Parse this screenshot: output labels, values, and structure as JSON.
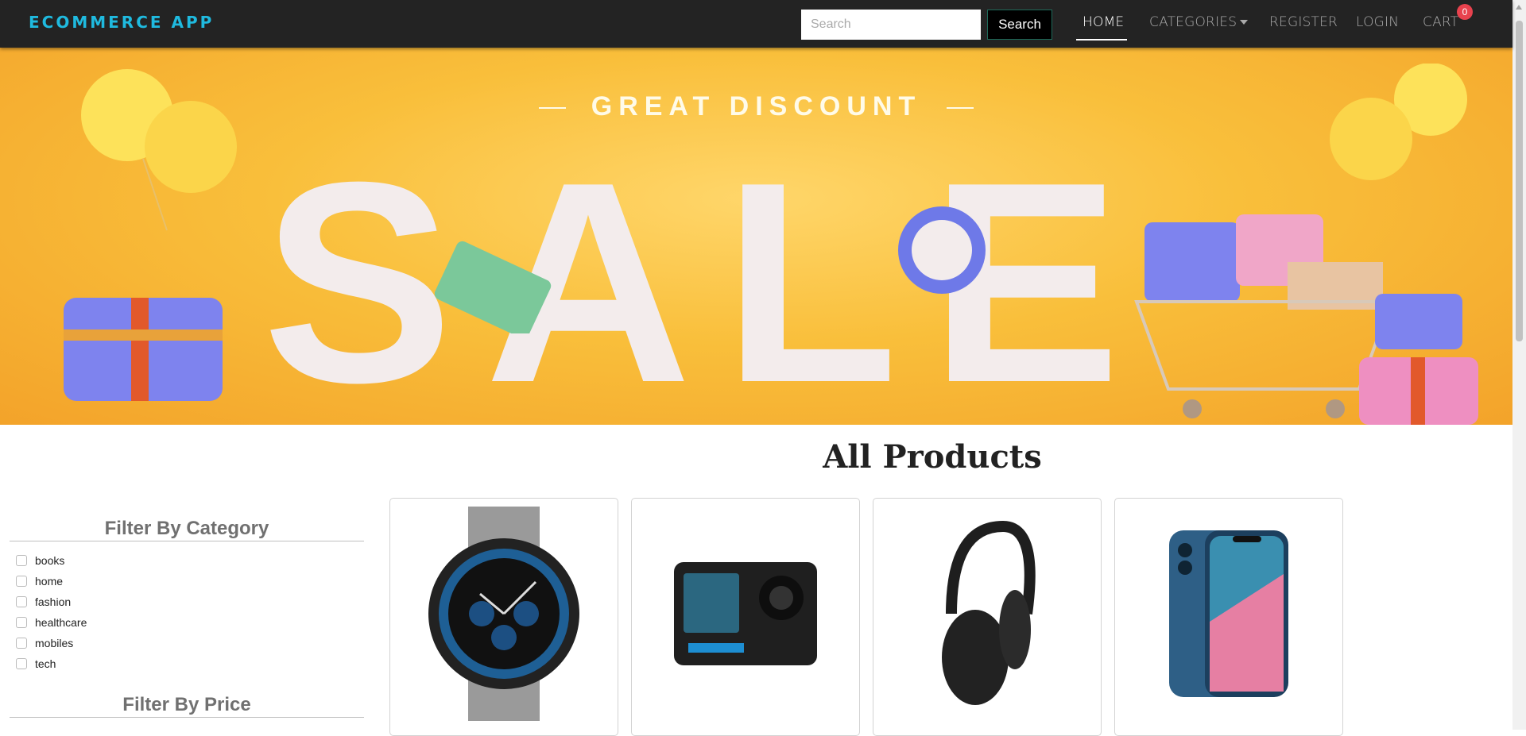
{
  "navbar": {
    "brand": "ECOMMERCE APP",
    "search_placeholder": "Search",
    "search_button": "Search",
    "links": {
      "home": "HOME",
      "categories": "CATEGORIES",
      "register": "REGISTER",
      "login": "LOGIN",
      "cart": "CART"
    },
    "cart_count": "0"
  },
  "banner": {
    "headline": "GREAT DISCOUNT",
    "big_word": "SALE"
  },
  "main": {
    "title": "All Products"
  },
  "filters": {
    "category_title": "Filter By Category",
    "categories": [
      "books",
      "home",
      "fashion",
      "healthcare",
      "mobiles",
      "tech"
    ],
    "price_title": "Filter By Price"
  },
  "products": [
    {
      "icon": "watch-icon"
    },
    {
      "icon": "action-camera-icon"
    },
    {
      "icon": "headphones-icon"
    },
    {
      "icon": "smartphone-icon"
    }
  ],
  "colors": {
    "brand": "#1fbadf",
    "navbar_bg": "#232323",
    "badge": "#e8424e",
    "banner": "#f9bf3b"
  }
}
